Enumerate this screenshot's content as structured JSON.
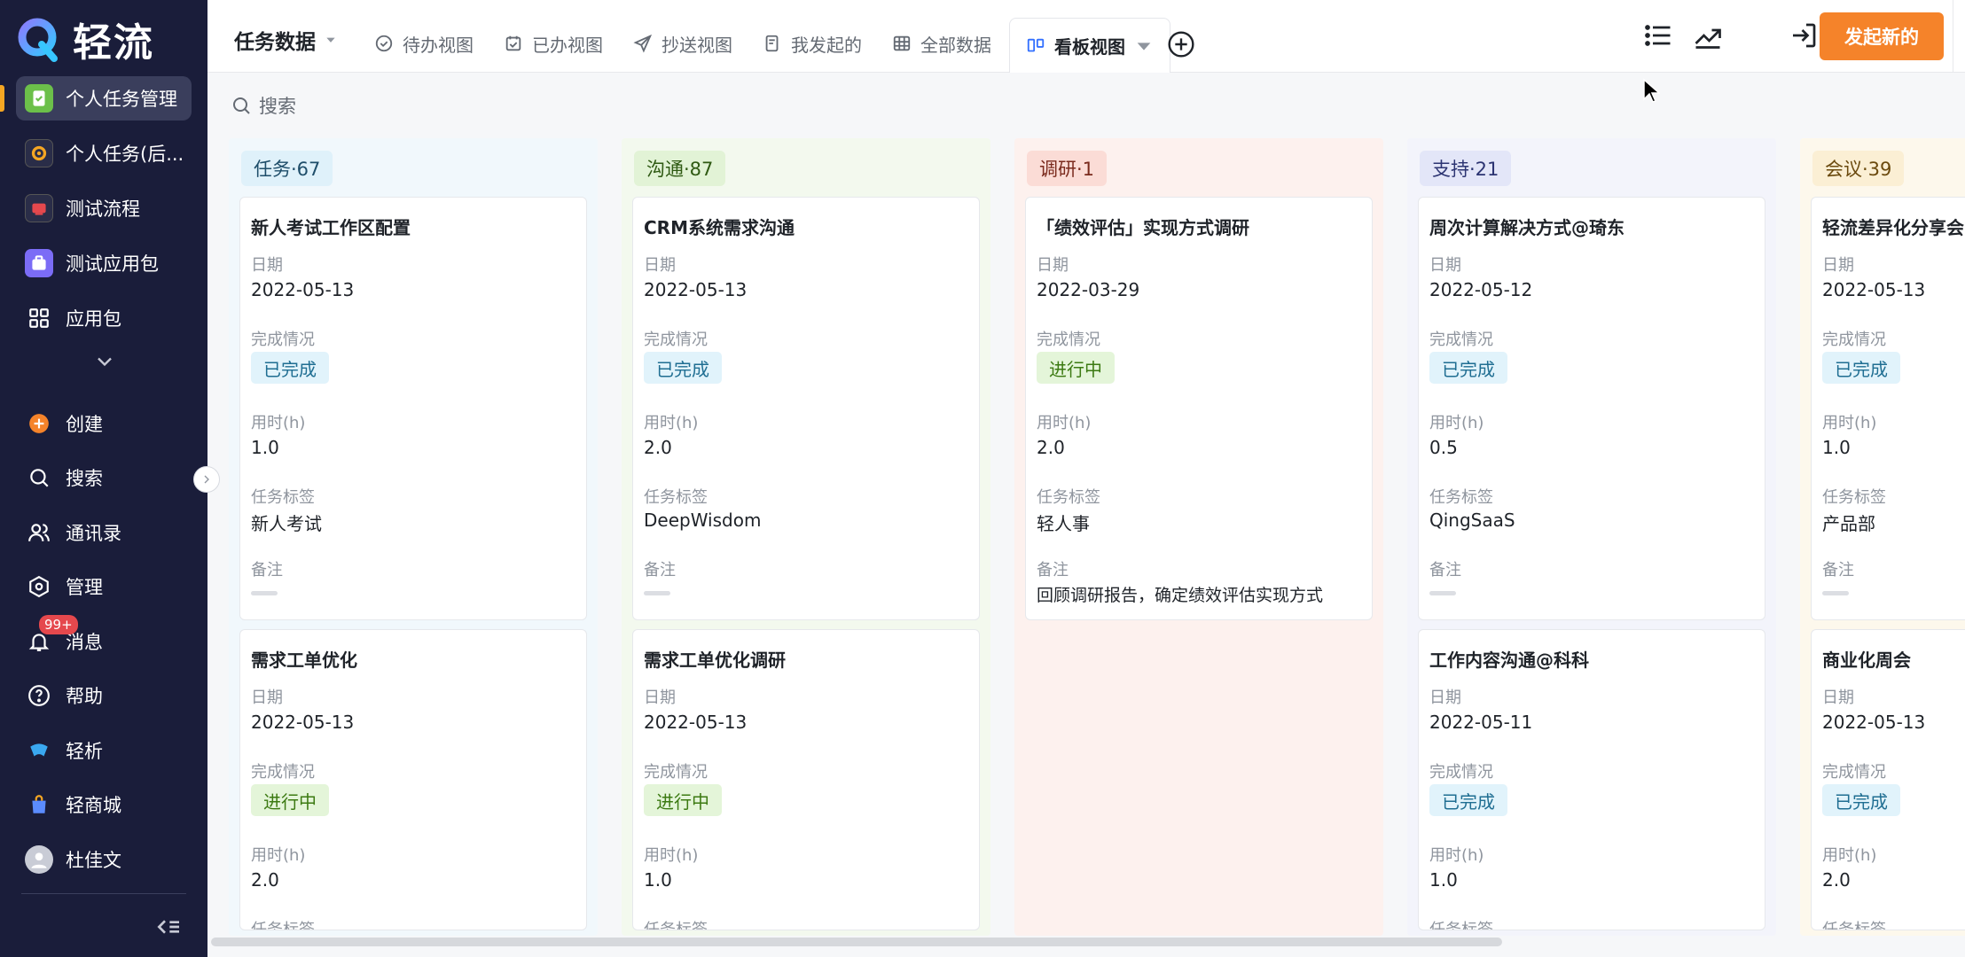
{
  "sidebar": {
    "brand": "轻流",
    "items": [
      {
        "label": "个人任务管理"
      },
      {
        "label": "个人任务(后..."
      },
      {
        "label": "测试流程"
      },
      {
        "label": "测试应用包"
      },
      {
        "label": "应用包"
      },
      {
        "label": "创建"
      },
      {
        "label": "搜索"
      },
      {
        "label": "通讯录"
      },
      {
        "label": "管理"
      },
      {
        "label": "消息"
      },
      {
        "label": "帮助"
      },
      {
        "label": "轻析"
      },
      {
        "label": "轻商城"
      },
      {
        "label": "杜佳文"
      }
    ],
    "message_badge": "99+"
  },
  "header": {
    "title": "任务数据",
    "tabs": [
      {
        "label": "待办视图"
      },
      {
        "label": "已办视图"
      },
      {
        "label": "抄送视图"
      },
      {
        "label": "我发起的"
      },
      {
        "label": "全部数据"
      },
      {
        "label": "看板视图"
      }
    ],
    "primary_button": "发起新的"
  },
  "search": {
    "label": "搜索"
  },
  "board": {
    "columns": [
      {
        "title": "任务·67",
        "cards": [
          {
            "title": "新人考试工作区配置",
            "date_label": "日期",
            "date": "2022-05-13",
            "status_label": "完成情况",
            "status": "已完成",
            "hours_label": "用时(h)",
            "hours": "1.0",
            "tag_label": "任务标签",
            "tag": "新人考试",
            "note_label": "备注",
            "note": ""
          },
          {
            "title": "需求工单优化",
            "date_label": "日期",
            "date": "2022-05-13",
            "status_label": "完成情况",
            "status": "进行中",
            "hours_label": "用时(h)",
            "hours": "2.0",
            "tag_label": "任务标签"
          }
        ]
      },
      {
        "title": "沟通·87",
        "cards": [
          {
            "title": "CRM系统需求沟通",
            "date_label": "日期",
            "date": "2022-05-13",
            "status_label": "完成情况",
            "status": "已完成",
            "hours_label": "用时(h)",
            "hours": "2.0",
            "tag_label": "任务标签",
            "tag": "DeepWisdom",
            "note_label": "备注",
            "note": ""
          },
          {
            "title": "需求工单优化调研",
            "date_label": "日期",
            "date": "2022-05-13",
            "status_label": "完成情况",
            "status": "进行中",
            "hours_label": "用时(h)",
            "hours": "1.0",
            "tag_label": "任务标签"
          }
        ]
      },
      {
        "title": "调研·1",
        "cards": [
          {
            "title": "「绩效评估」实现方式调研",
            "date_label": "日期",
            "date": "2022-03-29",
            "status_label": "完成情况",
            "status": "进行中",
            "hours_label": "用时(h)",
            "hours": "2.0",
            "tag_label": "任务标签",
            "tag": "轻人事",
            "note_label": "备注",
            "note": "回顾调研报告，确定绩效评估实现方式"
          }
        ]
      },
      {
        "title": "支持·21",
        "cards": [
          {
            "title": "周次计算解决方式@琦东",
            "date_label": "日期",
            "date": "2022-05-12",
            "status_label": "完成情况",
            "status": "已完成",
            "hours_label": "用时(h)",
            "hours": "0.5",
            "tag_label": "任务标签",
            "tag": "QingSaaS",
            "note_label": "备注",
            "note": ""
          },
          {
            "title": "工作内容沟通@科科",
            "date_label": "日期",
            "date": "2022-05-11",
            "status_label": "完成情况",
            "status": "已完成",
            "hours_label": "用时(h)",
            "hours": "1.0",
            "tag_label": "任务标签"
          }
        ]
      },
      {
        "title": "会议·39",
        "cards": [
          {
            "title": "轻流差异化分享会",
            "date_label": "日期",
            "date": "2022-05-13",
            "status_label": "完成情况",
            "status": "已完成",
            "hours_label": "用时(h)",
            "hours": "1.0",
            "tag_label": "任务标签",
            "tag": "产品部",
            "note_label": "备注",
            "note": ""
          },
          {
            "title": "商业化周会",
            "date_label": "日期",
            "date": "2022-05-13",
            "status_label": "完成情况",
            "status": "已完成",
            "hours_label": "用时(h)",
            "hours": "2.0",
            "tag_label": "任务标签"
          }
        ]
      }
    ]
  },
  "colors": {
    "sidebar_bg": "#1a1d3a",
    "accent": "#f5832a",
    "status_done_bg": "#e1f3fb",
    "status_doing_bg": "#e4f5d9"
  }
}
